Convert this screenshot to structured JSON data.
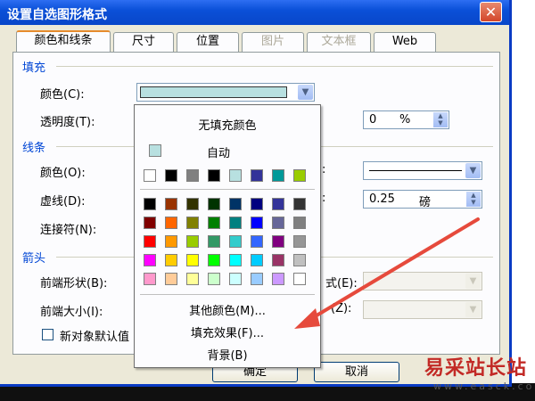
{
  "window": {
    "title": "设置自选图形格式",
    "close_glyph": "✕"
  },
  "tabs": [
    {
      "label": "颜色和线条",
      "state": "active"
    },
    {
      "label": "尺寸",
      "state": "normal"
    },
    {
      "label": "位置",
      "state": "normal"
    },
    {
      "label": "图片",
      "state": "disabled"
    },
    {
      "label": "文本框",
      "state": "disabled"
    },
    {
      "label": "Web",
      "state": "normal"
    }
  ],
  "fill": {
    "heading": "填充",
    "color_label": "颜色(C):",
    "color_value": "#b8e0e0",
    "transparency_label": "透明度(T):",
    "transparency_value": "0",
    "transparency_unit": "%"
  },
  "line": {
    "heading": "线条",
    "color_label": "颜色(O):",
    "dash_label": "虚线(D):",
    "connector_label": "连接符(N):",
    "weight_value": "0.25",
    "weight_unit": "磅"
  },
  "arrows": {
    "heading": "箭头",
    "begin_style_label": "前端形状(B):",
    "begin_size_label": "前端大小(I):",
    "end_style_label_partial": "式(E):",
    "end_size_label_partial": "(Z):"
  },
  "default_checkbox_label": "新对象默认值",
  "buttons": {
    "ok": "确定",
    "cancel": "取消"
  },
  "popup": {
    "no_fill": "无填充颜色",
    "automatic": "自动",
    "automatic_color": "#b8e0e0",
    "recent_colors": [
      "#ffffff",
      "#000000",
      "#808080",
      "#000000",
      "#b8e0e0",
      "#333399",
      "#009999",
      "#99cc00"
    ],
    "palette": [
      [
        "#000000",
        "#993300",
        "#333300",
        "#003300",
        "#003366",
        "#000080",
        "#333399",
        "#333333"
      ],
      [
        "#800000",
        "#ff6600",
        "#808000",
        "#008000",
        "#008080",
        "#0000ff",
        "#666699",
        "#808080"
      ],
      [
        "#ff0000",
        "#ff9900",
        "#99cc00",
        "#339966",
        "#33cccc",
        "#3366ff",
        "#800080",
        "#969696"
      ],
      [
        "#ff00ff",
        "#ffcc00",
        "#ffff00",
        "#00ff00",
        "#00ffff",
        "#00ccff",
        "#993366",
        "#c0c0c0"
      ],
      [
        "#ff99cc",
        "#ffcc99",
        "#ffff99",
        "#ccffcc",
        "#ccffff",
        "#99ccff",
        "#cc99ff",
        "#ffffff"
      ]
    ],
    "more_colors": "其他颜色(M)...",
    "fill_effects": "填充效果(F)...",
    "background": "背景(B)"
  },
  "annotation": {
    "arrow_color": "#e64a3c"
  },
  "watermark": {
    "title": "易采站长站",
    "url": "www.easck.com"
  }
}
